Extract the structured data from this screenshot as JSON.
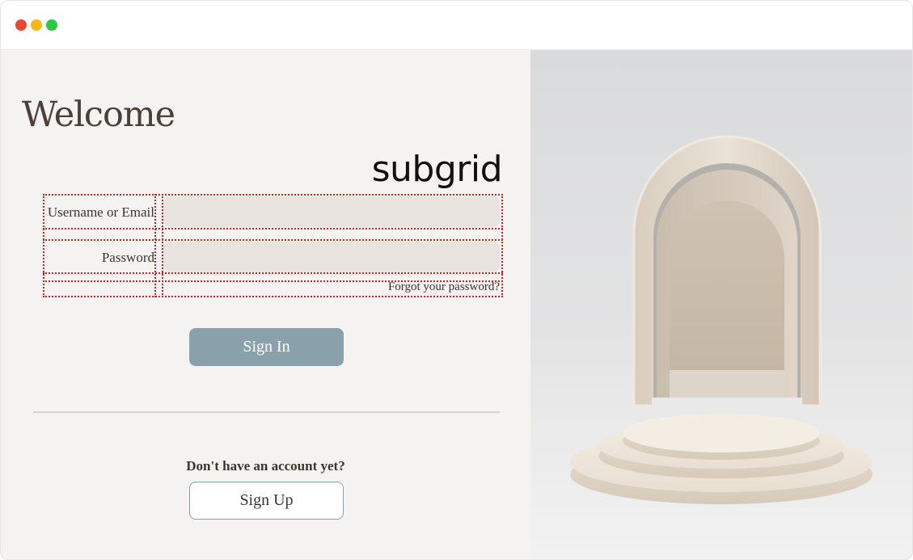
{
  "window": {
    "controls": [
      "close",
      "minimize",
      "maximize"
    ]
  },
  "login": {
    "heading": "Welcome",
    "grid_label": "subgrid",
    "username_label": "Username or Email",
    "username_value": "",
    "password_label": "Password",
    "password_value": "",
    "forgot_link": "Forgot your password?",
    "signin_button": "Sign In",
    "signup_prompt": "Don't have an account yet?",
    "signup_button": "Sign Up"
  },
  "colors": {
    "left_background": "#f4f3f1",
    "input_background": "#e8e3de",
    "primary_button": "#8aa1ab",
    "grid_overlay": "#cc2222",
    "heading_text": "#4a4038"
  },
  "hero": {
    "description_icon": "arch-pedestal-illustration"
  }
}
